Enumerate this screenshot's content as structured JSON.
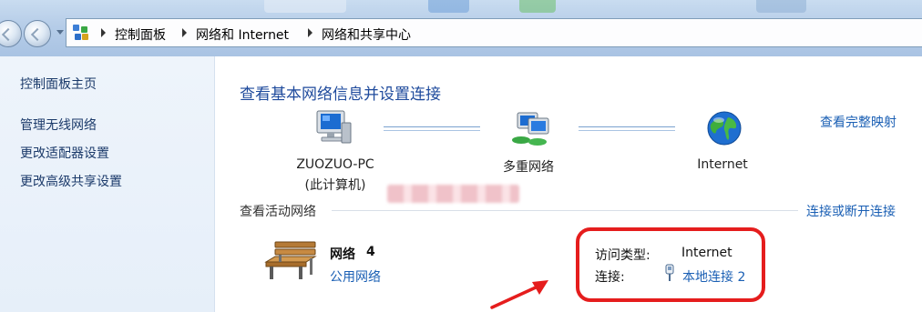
{
  "breadcrumb": {
    "items": [
      "控制面板",
      "网络和 Internet",
      "网络和共享中心"
    ]
  },
  "left_pane": {
    "links": [
      "控制面板主页",
      "管理无线网络",
      "更改适配器设置",
      "更改高级共享设置"
    ]
  },
  "main": {
    "heading": "查看基本网络信息并设置连接",
    "map_nodes": {
      "computer_name": "ZUOZUO-PC",
      "computer_sub": "(此计算机)",
      "middle": "多重网络",
      "internet": "Internet"
    },
    "view_full_map": "查看完整映射",
    "active_networks_title": "查看活动网络",
    "connect_disconnect": "连接或断开连接",
    "network": {
      "name": "网络",
      "number": "4",
      "type_link": "公用网络"
    },
    "properties": {
      "access_type_label": "访问类型:",
      "access_type_value": "Internet",
      "connection_label": "连接:",
      "connection_value": "本地连接 2"
    }
  },
  "colors": {
    "link": "#1a5fb4",
    "heading": "#1e4a9c",
    "highlight": "#e51d1d"
  }
}
